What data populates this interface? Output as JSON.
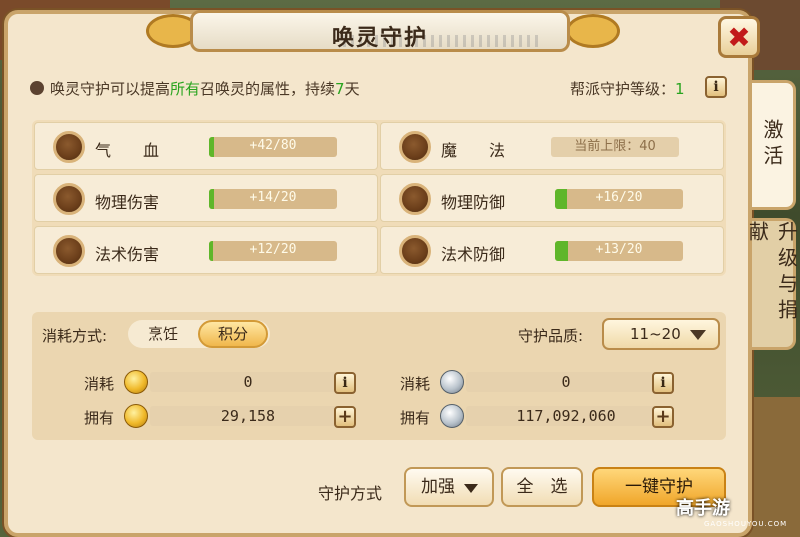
{
  "title": "唤灵守护",
  "description": {
    "part1": "唤灵守护可以提高",
    "highlight": "所有",
    "part2": "召唤灵的属性，持续",
    "days": "7",
    "unit": "天"
  },
  "guard_level": {
    "label": "帮派守护等级：",
    "value": "1"
  },
  "tabs": [
    {
      "label": "激活",
      "active": true
    },
    {
      "label": "升级与捐献",
      "active": false
    }
  ],
  "stats": [
    {
      "name": "气　　血",
      "value": "+42/80",
      "progress": 0.04
    },
    {
      "name": "魔　　法",
      "cap": "当前上限：40"
    },
    {
      "name": "物理伤害",
      "value": "+14/20",
      "progress": 0.04
    },
    {
      "name": "物理防御",
      "value": "+16/20",
      "progress": 0.09
    },
    {
      "name": "法术伤害",
      "value": "+12/20",
      "progress": 0.03
    },
    {
      "name": "法术防御",
      "value": "+13/20",
      "progress": 0.1
    }
  ],
  "consume": {
    "label": "消耗方式:",
    "options": [
      "烹饪",
      "积分"
    ],
    "selected": "积分"
  },
  "quality": {
    "label": "守护品质:",
    "value": "11~20"
  },
  "resources": {
    "gold": {
      "cost_label": "消耗",
      "cost": "0",
      "own_label": "拥有",
      "own": "29,158"
    },
    "silver": {
      "cost_label": "消耗",
      "cost": "0",
      "own_label": "拥有",
      "own": "117,092,060"
    }
  },
  "actions": {
    "method_label": "守护方式",
    "mode_button": "加强",
    "select_all": "全　选",
    "one_click": "一键守护"
  },
  "watermark": {
    "brand": "高手游",
    "sub": "GAOSHOUYOU.COM"
  },
  "colors": {
    "accent_green": "#28a41e",
    "panel": "#f4e6cc",
    "border": "#c9a46a"
  }
}
